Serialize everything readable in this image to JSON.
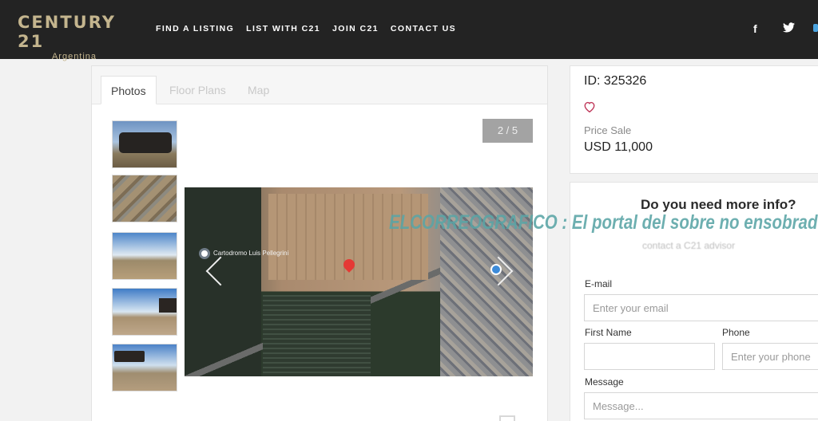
{
  "header": {
    "logo": {
      "main": "CENTURY 21",
      "sub": "Argentina"
    },
    "nav": [
      "FIND A LISTING",
      "LIST WITH C21",
      "JOIN C21",
      "CONTACT US"
    ],
    "social": {
      "facebook": "f"
    }
  },
  "gallery": {
    "tabs": [
      "Photos",
      "Floor Plans",
      "Map"
    ],
    "counter": "2 / 5",
    "map_label": "Cartodromo Luis Pellegrini"
  },
  "listing": {
    "id_text": "ID: 325326",
    "price_label": "Price Sale",
    "price_value": "USD 11,000"
  },
  "contact": {
    "title": "Do you need more info?",
    "blurred_line": "contact a C21 advisor",
    "email_label": "E-mail",
    "email_placeholder": "Enter your email",
    "first_name_label": "First Name",
    "phone_label": "Phone",
    "phone_placeholder": "Enter your phone",
    "message_label": "Message",
    "message_placeholder": "Message..."
  },
  "watermark": "ELCORREOGRAFICO : El portal del sobre no ensobrado",
  "colors": {
    "header_bg": "#232323",
    "logo_gold": "#c4b58e",
    "watermark": "#5aa5a6",
    "heart": "#c0395b"
  }
}
